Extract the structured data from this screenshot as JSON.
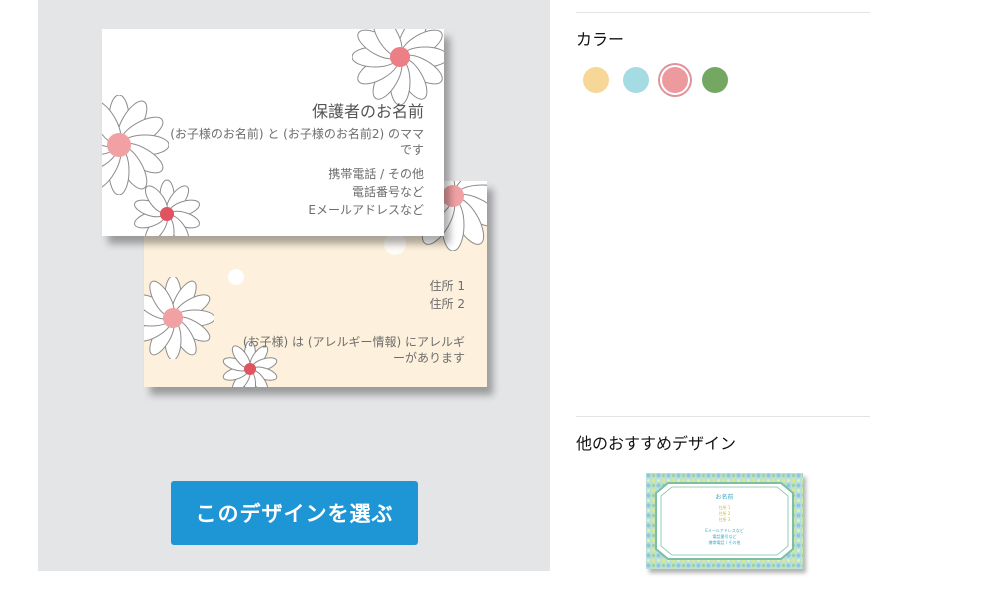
{
  "preview": {
    "front": {
      "name": "保護者のお名前",
      "subtitle": "(お子様のお名前) と (お子様のお名前2) のママです",
      "contact": [
        "携帯電話 / その他",
        "電話番号など",
        "Eメールアドレスなど"
      ]
    },
    "back": {
      "address": [
        "住所 1",
        "住所 2"
      ],
      "allergy": "(お子様) は (アレルギー情報) にアレルギーがあります"
    },
    "choose_button": "このデザインを選ぶ"
  },
  "sidebar": {
    "color_title": "カラー",
    "colors": [
      {
        "name": "yellow",
        "hex": "#f6d797"
      },
      {
        "name": "blue",
        "hex": "#a5dbe3"
      },
      {
        "name": "pink",
        "hex": "#ec9a9e",
        "selected": true
      },
      {
        "name": "green",
        "hex": "#74a862"
      }
    ],
    "recommend_title": "他のおすすめデザイン",
    "recommend_thumb": {
      "name": "お名前",
      "lines": [
        "住所 1",
        "住所 2",
        "住所 3",
        "Eメールアドレスなど",
        "電話番号など",
        "携帯電話 / その他"
      ]
    }
  },
  "colors": {
    "panel_bg": "#e4e5e7",
    "button": "#1e96d6",
    "back_card": "#fdf0dc"
  }
}
